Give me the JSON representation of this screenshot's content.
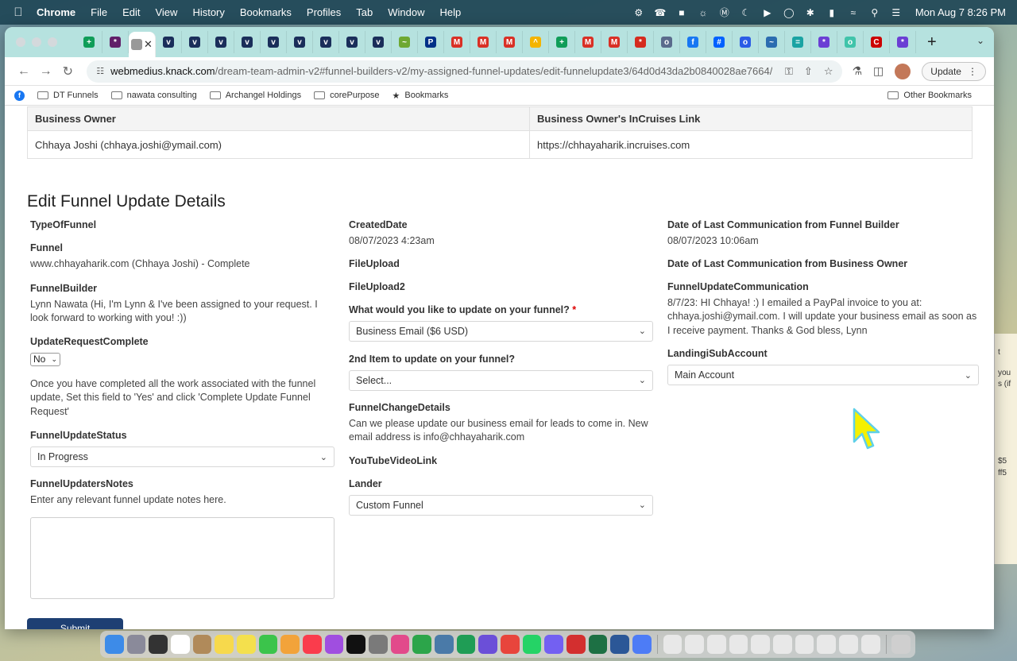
{
  "menubar": {
    "app": "Chrome",
    "items": [
      "File",
      "Edit",
      "View",
      "History",
      "Bookmarks",
      "Profiles",
      "Tab",
      "Window",
      "Help"
    ],
    "clock": "Mon Aug 7  8:26 PM"
  },
  "browser": {
    "url_host": "webmedius.knack.com",
    "url_path": "/dream-team-admin-v2#funnel-builders-v2/my-assigned-funnel-updates/edit-funnelupdate3/64d0d43da2b0840028ae7664/",
    "update_label": "Update",
    "bookmarks": [
      "DT Funnels",
      "nawata consulting",
      "Archangel Holdings",
      "corePurpose",
      "Bookmarks"
    ],
    "other_bookmarks": "Other Bookmarks",
    "tabs": [
      {
        "icon": "sheets-icon",
        "color": "#0f9d58",
        "glyph": "+"
      },
      {
        "icon": "slack-icon",
        "color": "#611f69",
        "glyph": "*"
      },
      {
        "icon": "active-tab-icon",
        "color": "#999999",
        "glyph": ""
      },
      {
        "icon": "vimeo-icon",
        "color": "#1a2e5a",
        "glyph": "v"
      },
      {
        "icon": "vimeo-icon",
        "color": "#1a2e5a",
        "glyph": "v"
      },
      {
        "icon": "vimeo-icon",
        "color": "#1a2e5a",
        "glyph": "v"
      },
      {
        "icon": "vimeo-icon",
        "color": "#1a2e5a",
        "glyph": "v"
      },
      {
        "icon": "vimeo-icon",
        "color": "#1a2e5a",
        "glyph": "v"
      },
      {
        "icon": "vimeo-icon",
        "color": "#1a2e5a",
        "glyph": "v"
      },
      {
        "icon": "vimeo-icon",
        "color": "#1a2e5a",
        "glyph": "v"
      },
      {
        "icon": "vimeo-icon",
        "color": "#1a2e5a",
        "glyph": "v"
      },
      {
        "icon": "vimeo-icon",
        "color": "#1a2e5a",
        "glyph": "v"
      },
      {
        "icon": "leaf-icon",
        "color": "#6ea832",
        "glyph": "~"
      },
      {
        "icon": "paypal-icon",
        "color": "#003087",
        "glyph": "P"
      },
      {
        "icon": "gmail-icon",
        "color": "#d93025",
        "glyph": "M"
      },
      {
        "icon": "gmail-icon",
        "color": "#d93025",
        "glyph": "M"
      },
      {
        "icon": "gmail-icon",
        "color": "#d93025",
        "glyph": "M"
      },
      {
        "icon": "drive-icon",
        "color": "#f4b400",
        "glyph": "^"
      },
      {
        "icon": "sheets-icon",
        "color": "#0f9d58",
        "glyph": "+"
      },
      {
        "icon": "gmail-icon",
        "color": "#d93025",
        "glyph": "M"
      },
      {
        "icon": "gmail-icon",
        "color": "#d93025",
        "glyph": "M"
      },
      {
        "icon": "maple-leaf-icon",
        "color": "#d52b1e",
        "glyph": "*"
      },
      {
        "icon": "seal-icon",
        "color": "#5a6b8c",
        "glyph": "o"
      },
      {
        "icon": "facebook-icon",
        "color": "#1877f2",
        "glyph": "f"
      },
      {
        "icon": "dropbox-icon",
        "color": "#0061ff",
        "glyph": "#"
      },
      {
        "icon": "circle-icon",
        "color": "#2b5ce6",
        "glyph": "o"
      },
      {
        "icon": "chart-icon",
        "color": "#2b6cb0",
        "glyph": "~"
      },
      {
        "icon": "bars-icon",
        "color": "#1aa3a3",
        "glyph": "="
      },
      {
        "icon": "slack-icon",
        "color": "#6b3fd4",
        "glyph": "*"
      },
      {
        "icon": "teal-icon",
        "color": "#40c4aa",
        "glyph": "o"
      },
      {
        "icon": "cnn-icon",
        "color": "#cc0000",
        "glyph": "C"
      },
      {
        "icon": "slack-icon",
        "color": "#6b3fd4",
        "glyph": "*"
      }
    ]
  },
  "owner_table": {
    "headers": [
      "Business Owner",
      "Business Owner's InCruises Link"
    ],
    "row": [
      "Chhaya Joshi (chhaya.joshi@ymail.com)",
      "https://chhayaharik.incruises.com"
    ]
  },
  "form": {
    "title": "Edit Funnel Update Details",
    "col1": {
      "type_label": "TypeOfFunnel",
      "funnel_label": "Funnel",
      "funnel_value": "www.chhayaharik.com (Chhaya Joshi) - Complete",
      "builder_label": "FunnelBuilder",
      "builder_value": "Lynn Nawata (Hi, I'm Lynn & I've been assigned to your request. I look forward to working with you! :))",
      "complete_label": "UpdateRequestComplete",
      "complete_value": "No",
      "complete_help": "Once you have completed all the work associated with the funnel update, Set this field to 'Yes' and click 'Complete Update Funnel Request'",
      "status_label": "FunnelUpdateStatus",
      "status_value": "In Progress",
      "notes_label": "FunnelUpdatersNotes",
      "notes_help": "Enter any relevant funnel update notes here."
    },
    "col2": {
      "created_label": "CreatedDate",
      "created_value": "08/07/2023 4:23am",
      "file1_label": "FileUpload",
      "file2_label": "FileUpload2",
      "update_what_label": "What would you like to update on your funnel?",
      "required_mark": "*",
      "update_what_value": "Business Email ($6 USD)",
      "second_item_label": "2nd Item to update on your funnel?",
      "second_item_value": "Select...",
      "change_details_label": "FunnelChangeDetails",
      "change_details_value": "Can we please update our business email for leads to come in. New email address is info@chhayaharik.com",
      "youtube_label": "YouTubeVideoLink",
      "lander_label": "Lander",
      "lander_value": "Custom Funnel"
    },
    "col3": {
      "last_builder_label": "Date of Last Communication from Funnel Builder",
      "last_builder_value": "08/07/2023 10:06am",
      "last_owner_label": "Date of Last Communication from Business Owner",
      "communication_label": "FunnelUpdateCommunication",
      "communication_value": "8/7/23: HI Chhaya! :) I emailed a PayPal invoice to you at: chhaya.joshi@ymail.com. I will update your business email as soon as I receive payment. Thanks & God bless, Lynn",
      "subaccount_label": "LandingiSubAccount",
      "subaccount_value": "Main Account"
    },
    "submit_label": "Submit"
  },
  "bg_app_fragments": [
    "t",
    "you",
    "s (if",
    "$5",
    "ff5"
  ],
  "dock": [
    {
      "icon": "finder-icon",
      "color": "#3d8be8"
    },
    {
      "icon": "launchpad-icon",
      "color": "#8a8a9a"
    },
    {
      "icon": "mission-control-icon",
      "color": "#333333"
    },
    {
      "icon": "calendar-icon",
      "color": "#ffffff"
    },
    {
      "icon": "contacts-icon",
      "color": "#b08a5a"
    },
    {
      "icon": "notes-icon",
      "color": "#f7d94c"
    },
    {
      "icon": "stickies-icon",
      "color": "#f4e04d"
    },
    {
      "icon": "facetime-icon",
      "color": "#3bc44b"
    },
    {
      "icon": "photos-icon",
      "color": "#f2a33a"
    },
    {
      "icon": "music-icon",
      "color": "#fa3c4c"
    },
    {
      "icon": "podcasts-icon",
      "color": "#a04ee0"
    },
    {
      "icon": "tv-icon",
      "color": "#111111"
    },
    {
      "icon": "settings-icon",
      "color": "#7a7a7a"
    },
    {
      "icon": "color-picker-icon",
      "color": "#e24a8b"
    },
    {
      "icon": "vpn-icon",
      "color": "#2ca54a"
    },
    {
      "icon": "preview-icon",
      "color": "#4a7aa8"
    },
    {
      "icon": "sheets-icon",
      "color": "#1f9d55"
    },
    {
      "icon": "star-icon",
      "color": "#6b4fd8"
    },
    {
      "icon": "chrome-icon",
      "color": "#e8453c"
    },
    {
      "icon": "whatsapp-icon",
      "color": "#25d366"
    },
    {
      "icon": "viber-icon",
      "color": "#7360f2"
    },
    {
      "icon": "acrobat-icon",
      "color": "#d32f2f"
    },
    {
      "icon": "excel-icon",
      "color": "#1d7044"
    },
    {
      "icon": "word-icon",
      "color": "#2b5797"
    },
    {
      "icon": "messenger-icon",
      "color": "#4d7cf6"
    },
    {
      "icon": "window-thumb-icon",
      "color": "#e8e8e8"
    },
    {
      "icon": "window-thumb-icon",
      "color": "#e8e8e8"
    },
    {
      "icon": "window-thumb-icon",
      "color": "#e8e8e8"
    },
    {
      "icon": "window-thumb-icon",
      "color": "#e8e8e8"
    },
    {
      "icon": "window-thumb-icon",
      "color": "#e8e8e8"
    },
    {
      "icon": "window-thumb-icon",
      "color": "#e8e8e8"
    },
    {
      "icon": "window-thumb-icon",
      "color": "#e8e8e8"
    },
    {
      "icon": "window-thumb-icon",
      "color": "#e8e8e8"
    },
    {
      "icon": "window-thumb-icon",
      "color": "#e8e8e8"
    },
    {
      "icon": "window-thumb-icon",
      "color": "#e8e8e8"
    },
    {
      "icon": "trash-icon",
      "color": "#cfcfcf"
    }
  ],
  "accent_color": "#1e3f73"
}
